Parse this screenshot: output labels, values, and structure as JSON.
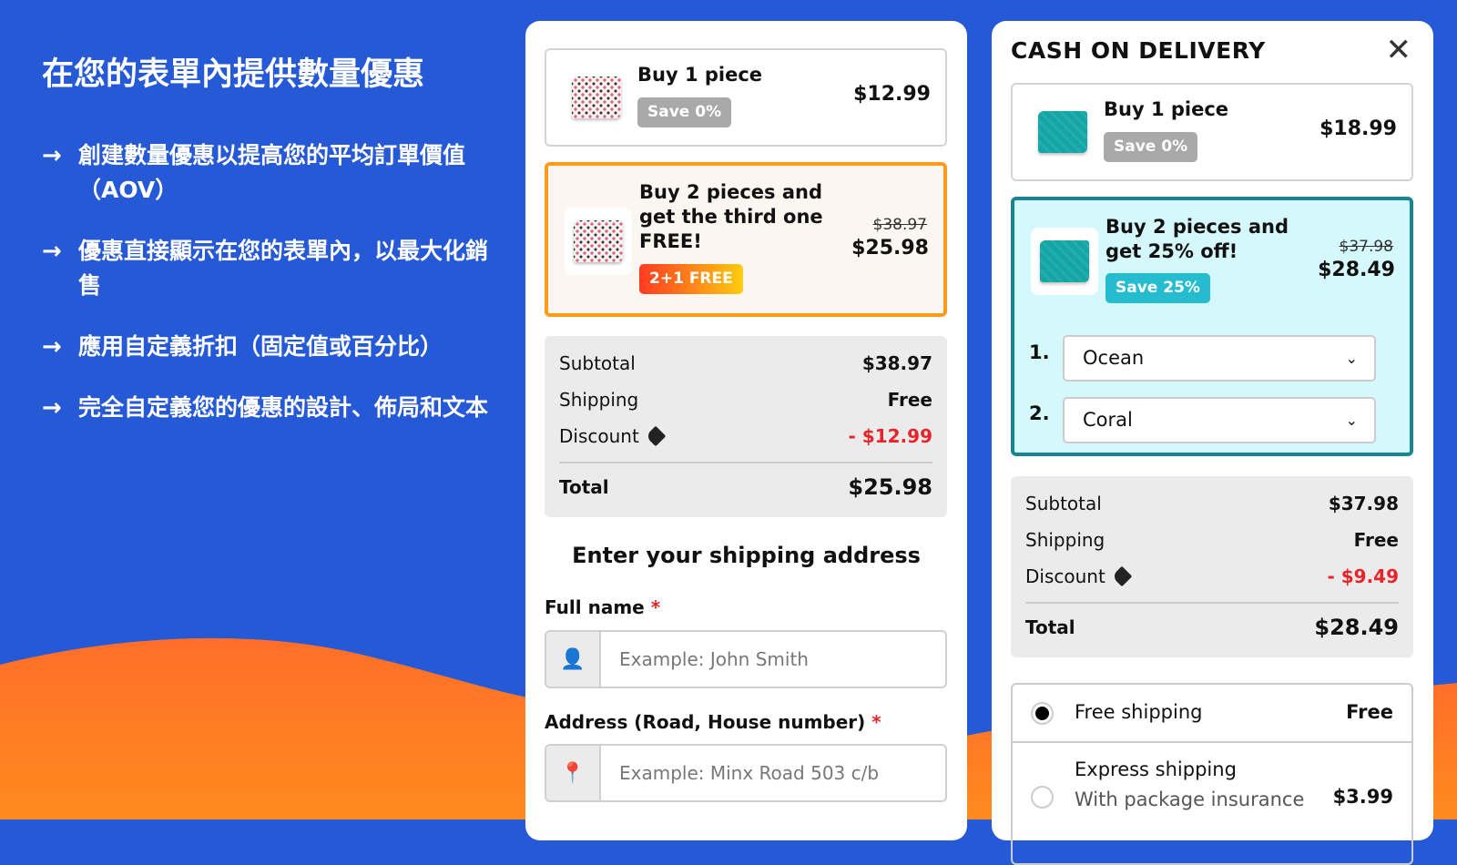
{
  "left": {
    "title": "在您的表單內提供數量優惠",
    "bullets": [
      "創建數量優惠以提高您的平均訂單價值（AOV）",
      "優惠直接顯示在您的表單內，以最大化銷售",
      "應用自定義折扣（固定值或百分比）",
      "完全自定義您的優惠的設計、佈局和文本"
    ]
  },
  "colors": {
    "background": "#2559d6",
    "orange": "#ff7a22",
    "selected_offer_border_1": "#ff9a1a",
    "selected_offer_border_2": "#1a8590",
    "teal_badge": "#25bccf"
  },
  "form1": {
    "offers": [
      {
        "title": "Buy 1 piece",
        "badge": "Save 0%",
        "price": "$12.99"
      },
      {
        "title": "Buy 2 pieces and get the third one FREE!",
        "badge": "2+1 FREE",
        "old_price": "$38.97",
        "price": "$25.98",
        "selected": true
      }
    ],
    "summary": {
      "subtotal_label": "Subtotal",
      "subtotal": "$38.97",
      "shipping_label": "Shipping",
      "shipping": "Free",
      "discount_label": "Discount",
      "discount": "- $12.99",
      "total_label": "Total",
      "total": "$25.98"
    },
    "address_heading": "Enter your shipping address",
    "fullname_label": "Full name",
    "fullname_placeholder": "Example: John Smith",
    "address_label": "Address (Road, House number)",
    "address_placeholder": "Example: Minx Road 503 c/b",
    "required": "*"
  },
  "form2": {
    "title": "CASH ON DELIVERY",
    "offers": [
      {
        "title": "Buy 1 piece",
        "badge": "Save 0%",
        "price": "$18.99"
      },
      {
        "title": "Buy 2 pieces and get 25% off!",
        "badge": "Save 25%",
        "old_price": "$37.98",
        "price": "$28.49",
        "selected": true
      }
    ],
    "variants": [
      {
        "num": "1.",
        "value": "Ocean"
      },
      {
        "num": "2.",
        "value": "Coral"
      }
    ],
    "summary": {
      "subtotal_label": "Subtotal",
      "subtotal": "$37.98",
      "shipping_label": "Shipping",
      "shipping": "Free",
      "discount_label": "Discount",
      "discount": "- $9.49",
      "total_label": "Total",
      "total": "$28.49"
    },
    "shipping_options": [
      {
        "label": "Free shipping",
        "price": "Free",
        "selected": true
      },
      {
        "label": "Express shipping",
        "sub": "With package insurance",
        "price": "$3.99",
        "selected": false
      }
    ]
  }
}
